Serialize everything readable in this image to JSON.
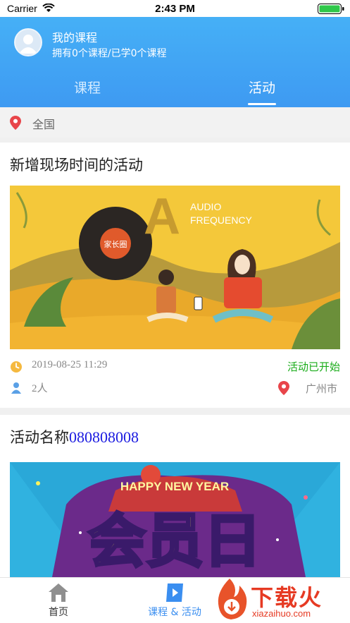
{
  "status_bar": {
    "carrier": "Carrier",
    "time": "2:43 PM"
  },
  "profile": {
    "title": "我的课程",
    "subtitle": "拥有0个课程/已学0个课程"
  },
  "tabs": [
    {
      "label": "课程",
      "active": false
    },
    {
      "label": "活动",
      "active": true
    }
  ],
  "location": {
    "label": "全国"
  },
  "activities": [
    {
      "title": "新增现场时间的活动",
      "image_text": {
        "letter": "A",
        "line1": "AUDIO",
        "line2": "FREQUENCY",
        "badge": "家长圈"
      },
      "datetime": "2019-08-25 11:29",
      "status": "活动已开始",
      "attendees": "2人",
      "city": "广州市"
    },
    {
      "title_prefix": "活动名称",
      "title_number": "080808008",
      "image_text": {
        "banner": "HAPPY NEW YEAR",
        "big": "会员日"
      }
    }
  ],
  "tabbar": [
    {
      "label": "首页"
    },
    {
      "label": "课程 & 活动"
    }
  ],
  "watermark": {
    "text": "下载火",
    "url": "xiazaihuo.com"
  },
  "colors": {
    "header_top": "#47b4f7",
    "header_bottom": "#3e9af2",
    "status_green": "#1aac1a",
    "accent_blue": "#3a8ef0",
    "pin_red": "#e8454a"
  }
}
